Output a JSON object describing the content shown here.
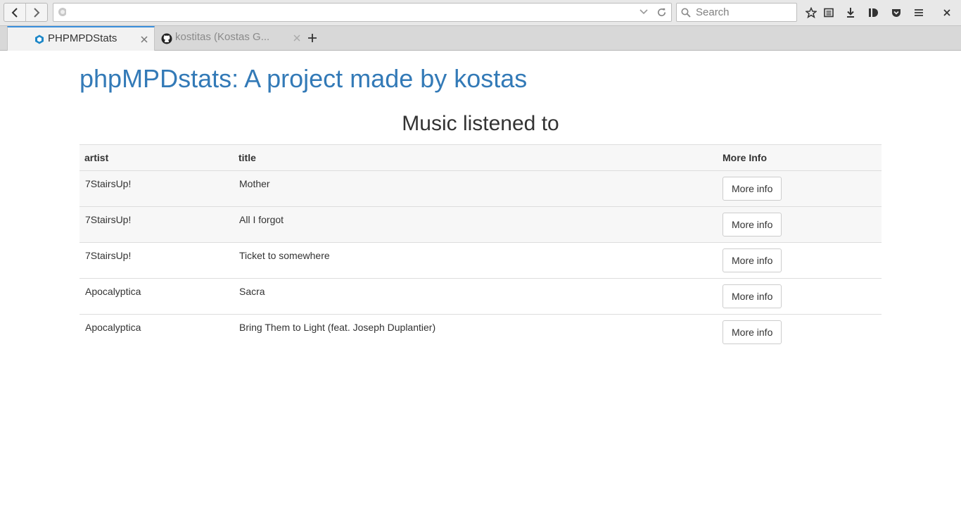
{
  "browser": {
    "search_placeholder": "Search",
    "tabs": [
      {
        "title": "PHPMPDStats",
        "active": true
      },
      {
        "title": "kostitas (Kostas G...",
        "active": false
      }
    ]
  },
  "page": {
    "site_title": "phpMPDstats: A project made by kostas",
    "section_title": "Music listened to",
    "table": {
      "headers": [
        "artist",
        "title",
        "More Info"
      ],
      "rows": [
        {
          "artist": "7StairsUp!",
          "title": "Mother",
          "button": "More info"
        },
        {
          "artist": "7StairsUp!",
          "title": "All I forgot",
          "button": "More info"
        },
        {
          "artist": "7StairsUp!",
          "title": "Ticket to somewhere",
          "button": "More info"
        },
        {
          "artist": "Apocalyptica",
          "title": "Sacra",
          "button": "More info"
        },
        {
          "artist": "Apocalyptica",
          "title": "Bring Them to Light (feat. Joseph Duplantier)",
          "button": "More info"
        }
      ]
    }
  },
  "colors": {
    "link_blue": "#337ab7",
    "tab_accent": "#3b8fdb"
  }
}
